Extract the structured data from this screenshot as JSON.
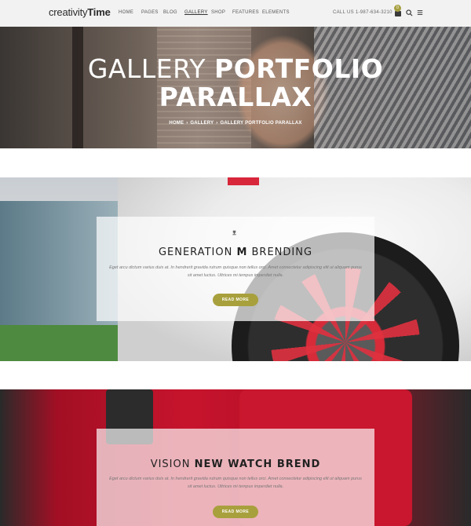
{
  "header": {
    "logo_light": "creativity",
    "logo_bold": "Time",
    "nav": [
      "HOME",
      "PAGES",
      "BLOG",
      "GALLERY",
      "SHOP",
      "FEATURES",
      "ELEMENTS"
    ],
    "nav_active": "GALLERY",
    "phone": "CALL US 1-987-634-3210",
    "cart_count": "0",
    "icons": [
      "cart-icon",
      "search-icon",
      "menu-icon"
    ]
  },
  "hero": {
    "title_light": "GALLERY ",
    "title_bold_1": "PORTFOLIO",
    "title_bold_2": "PARALLAX",
    "breadcrumb": [
      "HOME",
      "GALLERY",
      "GALLERY PORTFOLIO PARALLAX"
    ],
    "breadcrumb_sep": "›"
  },
  "items": [
    {
      "title_pre": "GENERATION ",
      "title_bold": "M",
      "title_post": " BRENDING",
      "text_line1": "Eget arcu dictum varius duis at. In hendrerit gravida rutrum quisque non tellus orci. Amet consectetur adipiscing elit ut aliquam purus",
      "text_line2": "sit amet luctus. Ultrices mi tempus imperdiet nulla.",
      "button": "READ MORE"
    },
    {
      "title_pre": "VISION ",
      "title_bold": "NEW WATCH BREND",
      "title_post": "",
      "text_line1": "Eget arcu dictum varius duis at. In hendrerit gravida rutrum quisque non tellus orci. Amet consectetur adipiscing elit ut aliquam purus",
      "text_line2": "sit amet luctus. Ultrices mi tempus imperdiet nulla.",
      "button": "READ MORE"
    }
  ],
  "colors": {
    "accent": "#a8a03d",
    "header_bg": "#f2f2f2"
  }
}
